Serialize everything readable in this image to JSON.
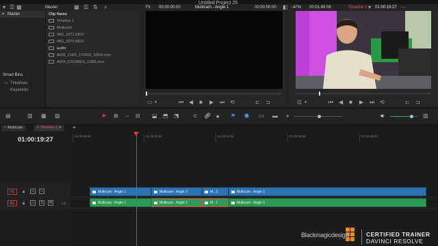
{
  "window": {
    "title": "Untitled Project 25"
  },
  "media_pool": {
    "bin_label": "Master",
    "bin_header": "Master",
    "column_header": "Clip Name",
    "clips": [
      "Timeline 1",
      "Multicam",
      "IMG_2071.MOV",
      "IMG_2070.MOV",
      "audio",
      "A005_C005_170502_93G4.mov",
      "A004_C0150831_C006.mov"
    ],
    "smart_bins_label": "Smart Bins",
    "smart_bins": [
      "Timelines",
      "Keywords"
    ]
  },
  "source_viewer": {
    "zoom": "Fit",
    "timecode": "00:00:00:00",
    "clip_name": "Multicam - Angle 1",
    "tc_right": "00:00:00:00"
  },
  "program_viewer": {
    "zoom": "47%",
    "duration": "00:01:48:08",
    "timeline_name": "Timeline 1",
    "timecode": "01:00:19:27"
  },
  "timeline": {
    "tabs": [
      "Multicam",
      "Timeline 1"
    ],
    "active_tab": "Timeline 1",
    "timecode": "01:00:19:27",
    "ruler": [
      "01:00:00:00",
      "01:00:22:00",
      "01:00:44:00",
      "01:01:06:00",
      "01:01:28:00"
    ],
    "tracks": {
      "v1": {
        "label": "V1"
      },
      "a1": {
        "label": "A1",
        "channels": "2.0"
      }
    },
    "video_clips": [
      "Multicam - Angle 1",
      "Multicam - Angle 2",
      "M...3",
      "Multicam - Angle 1"
    ],
    "audio_clips": [
      "Multicam - Angle 1",
      "Multicam - Angle 1",
      "M...1",
      "Multicam - Angle 1"
    ]
  },
  "branding": {
    "logo_text": "Blackmagicdesign",
    "certified_line1": "CERTIFIED TRAINER",
    "certified_line2": "DAVINCI RESOLVE"
  },
  "colors": {
    "accent_red": "#e03b3b",
    "video_clip": "#2c73b3",
    "audio_clip": "#2f9a58",
    "logo_orange": "#e08a2a"
  }
}
